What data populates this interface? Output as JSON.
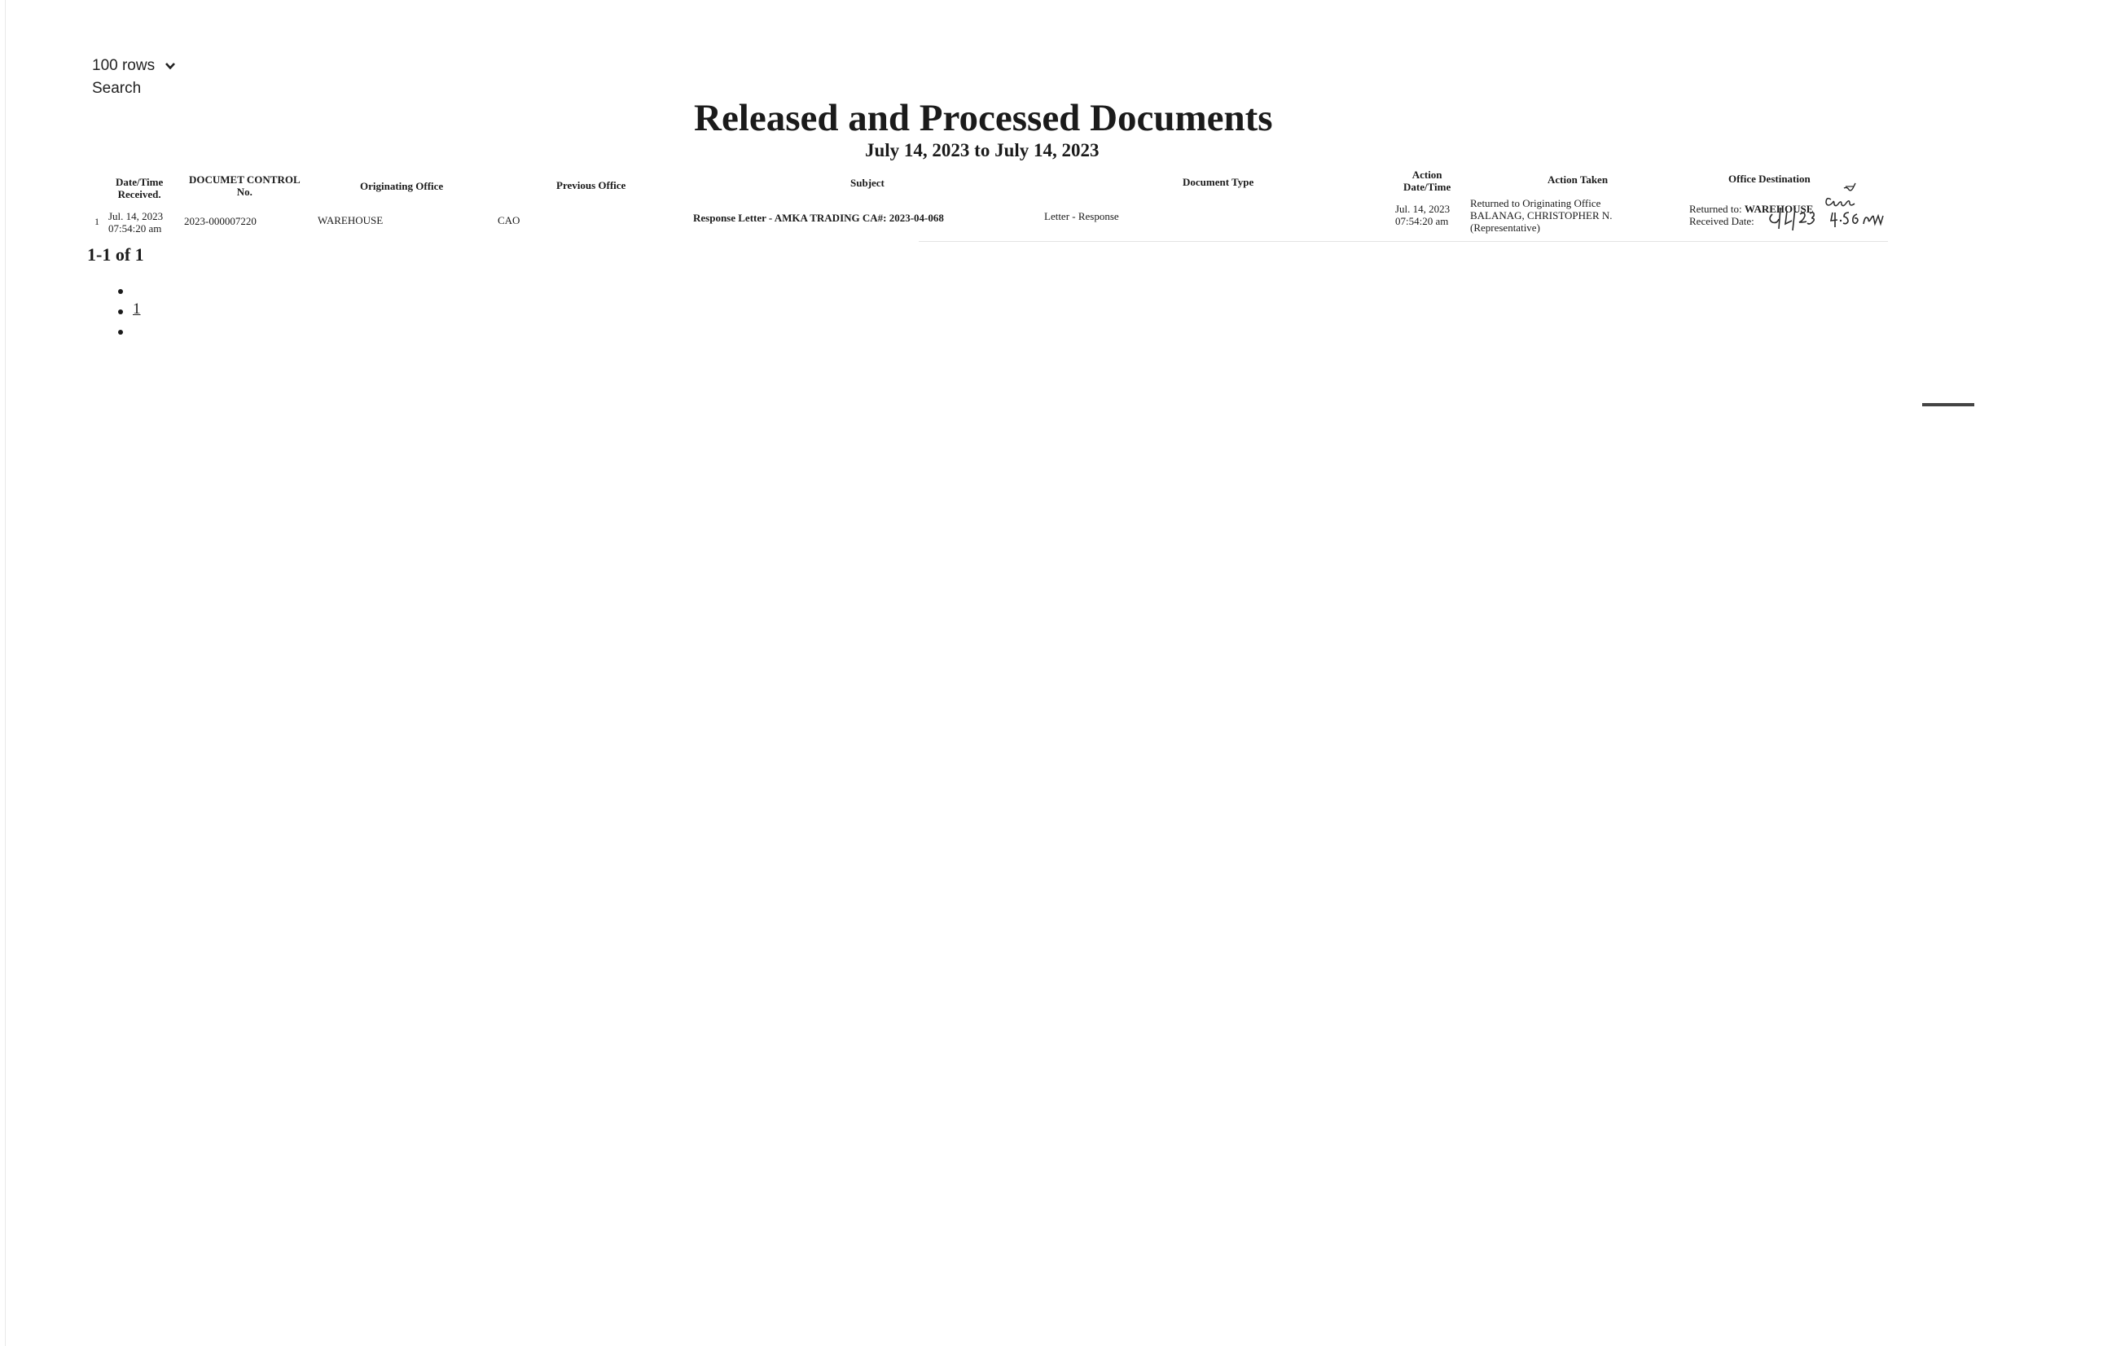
{
  "controls": {
    "rows_label": "100 rows",
    "search_label": "Search"
  },
  "report": {
    "title": "Released and Processed Documents",
    "date_range": "July 14, 2023 to July 14, 2023"
  },
  "table": {
    "headers": {
      "date_time_received_1": "Date/Time",
      "date_time_received_2": "Received.",
      "control_no_1": "DOCUMET CONTROL",
      "control_no_2": "No.",
      "originating_office": "Originating Office",
      "previous_office": "Previous Office",
      "subject": "Subject",
      "document_type": "Document Type",
      "action_date_1": "Action",
      "action_date_2": "Date/Time",
      "action_taken": "Action Taken",
      "office_destination": "Office Destination"
    },
    "rows": [
      {
        "index": "1",
        "received_date": "Jul. 14, 2023",
        "received_time": "07:54:20 am",
        "control_no": "2023-000007220",
        "originating_office": "WAREHOUSE",
        "previous_office": "CAO",
        "subject": "Response Letter - AMKA TRADING CA#: 2023-04-068",
        "document_type": "Letter - Response",
        "action_date": "Jul. 14, 2023",
        "action_time": "07:54:20 am",
        "action_taken_1": "Returned to Originating Office",
        "action_taken_2": "BALANAG, CHRISTOPHER N.",
        "action_taken_3": "(Representative)",
        "destination_1_label": "Returned to:",
        "destination_1_value": "WAREHOUSE",
        "destination_2_label": "Received Date:"
      }
    ]
  },
  "pagination": {
    "info": "1-1 of 1",
    "pages": [
      "1"
    ]
  }
}
